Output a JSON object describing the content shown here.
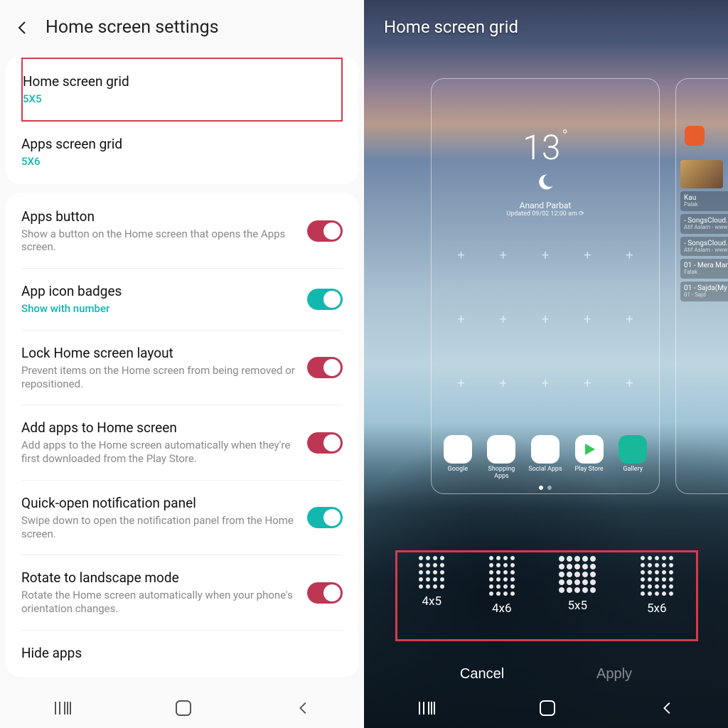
{
  "left": {
    "title": "Home screen settings",
    "card1": [
      {
        "title": "Home screen grid",
        "sub": "5X5"
      },
      {
        "title": "Apps screen grid",
        "sub": "5X6"
      }
    ],
    "card2": [
      {
        "title": "Apps button",
        "sub": "Show a button on the Home screen that opens the Apps screen.",
        "toggle": "pink"
      },
      {
        "title": "App icon badges",
        "sub": "Show with number",
        "accent": true,
        "toggle": "teal"
      },
      {
        "title": "Lock Home screen layout",
        "sub": "Prevent items on the Home screen from being removed or repositioned.",
        "toggle": "pink"
      },
      {
        "title": "Add apps to Home screen",
        "sub": "Add apps to the Home screen automatically when they're first downloaded from the Play Store.",
        "toggle": "pink"
      },
      {
        "title": "Quick-open notification panel",
        "sub": "Swipe down to open the notification panel from the Home screen.",
        "toggle": "teal"
      },
      {
        "title": "Rotate to landscape mode",
        "sub": "Rotate the Home screen automatically when your phone's orientation changes.",
        "toggle": "pink"
      },
      {
        "title": "Hide apps"
      }
    ]
  },
  "right": {
    "title": "Home screen grid",
    "weather": {
      "temp": "13",
      "loc": "Anand Parbat",
      "upd": "Updated 09/02 12:00 am ⟳"
    },
    "dock": [
      "Google",
      "Shopping Apps",
      "Social Apps",
      "Play Store",
      "Gallery"
    ],
    "music": [
      {
        "t": "Kau",
        "a": "Palak"
      },
      {
        "t": "- SongsCloud.",
        "a": "Atif Aslam - www"
      },
      {
        "t": "- SongsCloud.",
        "a": "Atif Aslam - www"
      },
      {
        "t": "01 - Mera Man",
        "a": "Falak"
      },
      {
        "t": "01 - Sajda(My",
        "a": "01 - Sajd"
      }
    ],
    "grid_options": [
      {
        "label": "4x5",
        "cols": 4,
        "rows": 5
      },
      {
        "label": "4x6",
        "cols": 4,
        "rows": 6
      },
      {
        "label": "5x5",
        "cols": 5,
        "rows": 5
      },
      {
        "label": "5x6",
        "cols": 5,
        "rows": 6
      }
    ],
    "cancel": "Cancel",
    "apply": "Apply"
  }
}
